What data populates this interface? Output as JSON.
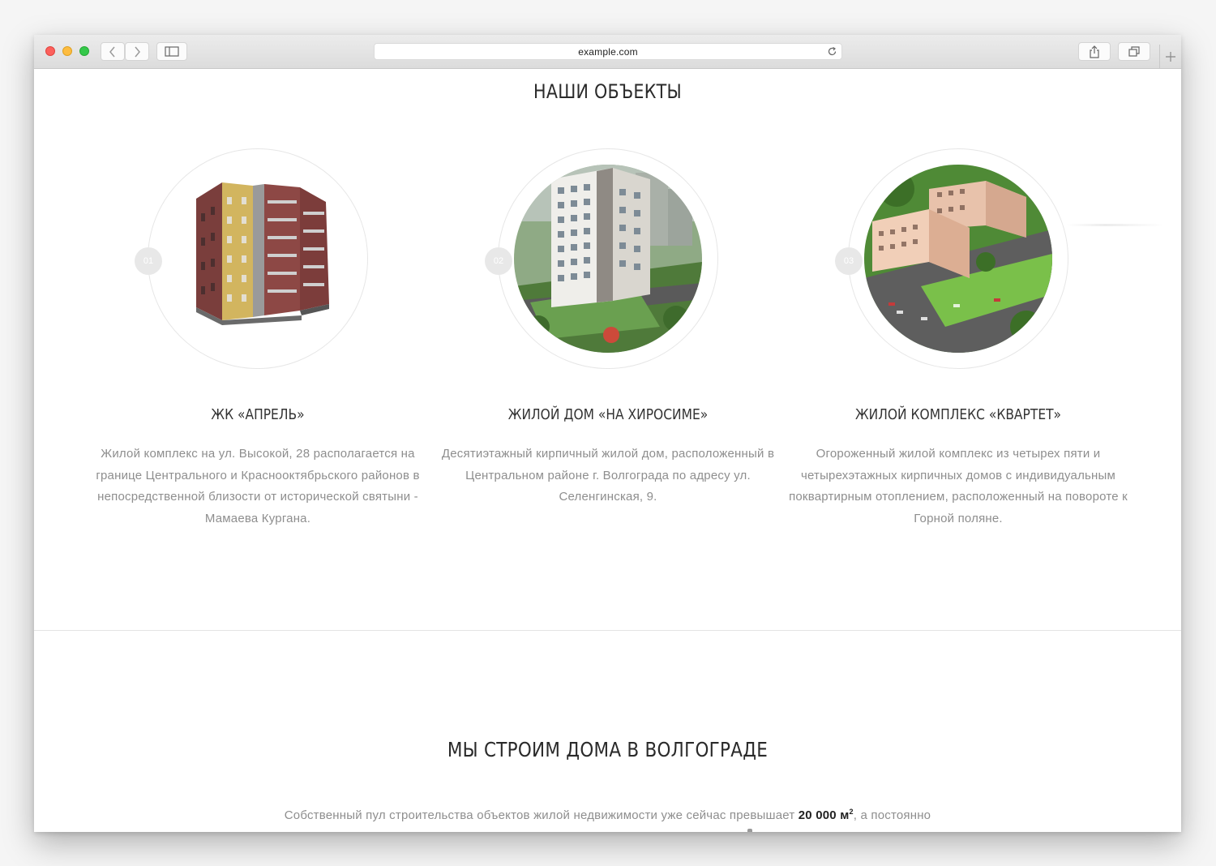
{
  "browser": {
    "url": "example.com",
    "colors": {
      "close": "#fc605c",
      "minimize": "#fdbc40",
      "zoom": "#34c84a"
    }
  },
  "objects_section": {
    "title": "НАШИ ОБЪЕКТЫ",
    "projects": [
      {
        "number": "01",
        "title": "ЖК «АПРЕЛЬ»",
        "description": "Жилой комплекс на ул. Высокой, 28 располагается на границе Центрального и Краснооктябрьского районов в непосредственной близости от исторической святыни - Мамаева Кургана."
      },
      {
        "number": "02",
        "title": "ЖИЛОЙ ДОМ «НА ХИРОСИМЕ»",
        "description": "Десятиэтажный кирпичный жилой дом, расположенный в Центральном районе г. Волгограда по адресу ул. Селенгинская, 9."
      },
      {
        "number": "03",
        "title": "ЖИЛОЙ КОМПЛЕКС «КВАРТЕТ»",
        "description": "Огороженный жилой комплекс из четырех пяти и четырехэтажных кирпичных домов с индивидуальным поквартирным отоплением, расположенный на повороте к Горной поляне."
      }
    ]
  },
  "building_section": {
    "title": "МЫ СТРОИМ ДОМА В ВОЛГОГРАДЕ",
    "intro_before": "Собственный пул строительства объектов жилой недвижимости уже сейчас превышает ",
    "intro_highlight": "20 000 м",
    "intro_highlight_sup": "2",
    "intro_after": ", а постоянно"
  }
}
